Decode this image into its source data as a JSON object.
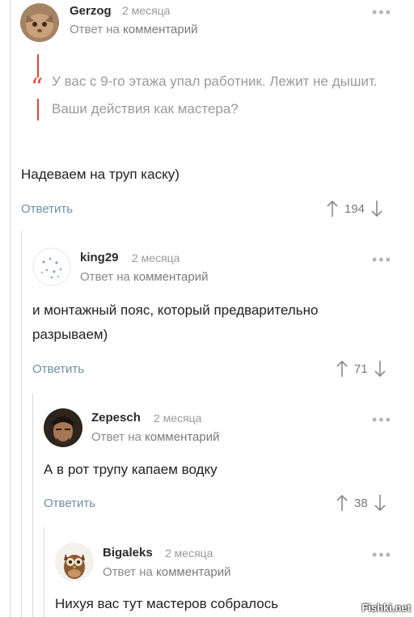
{
  "comments": [
    {
      "username": "Gerzog",
      "time": "2 месяца",
      "reply_prefix": "Ответ на",
      "reply_link": "комментарий",
      "quote": "У вас с 9-го этажа упал работник. Лежит не дышит. Ваши действия как мастера?",
      "text": "Надеваем на труп каску)",
      "reply_label": "Ответить",
      "votes": "194"
    },
    {
      "username": "king29",
      "time": "2 месяца",
      "reply_prefix": "Ответ на",
      "reply_link": "комментарий",
      "text": "и монтажный пояс, который предварительно разрываем)",
      "reply_label": "Ответить",
      "votes": "71"
    },
    {
      "username": "Zepesch",
      "time": "2 месяца",
      "reply_prefix": "Ответ на",
      "reply_link": "комментарий",
      "text": "А в рот трупу капаем водку",
      "reply_label": "Ответить",
      "votes": "38"
    },
    {
      "username": "Bigaleks",
      "time": "2 месяца",
      "reply_prefix": "Ответ на",
      "reply_link": "комментарий",
      "text": "Нихуя вас тут мастеров собралось"
    }
  ],
  "menu_icon": "more-horizontal-icon",
  "vote_icons": [
    "arrow-up-icon",
    "arrow-down-icon"
  ],
  "watermark": "Fishki.net"
}
